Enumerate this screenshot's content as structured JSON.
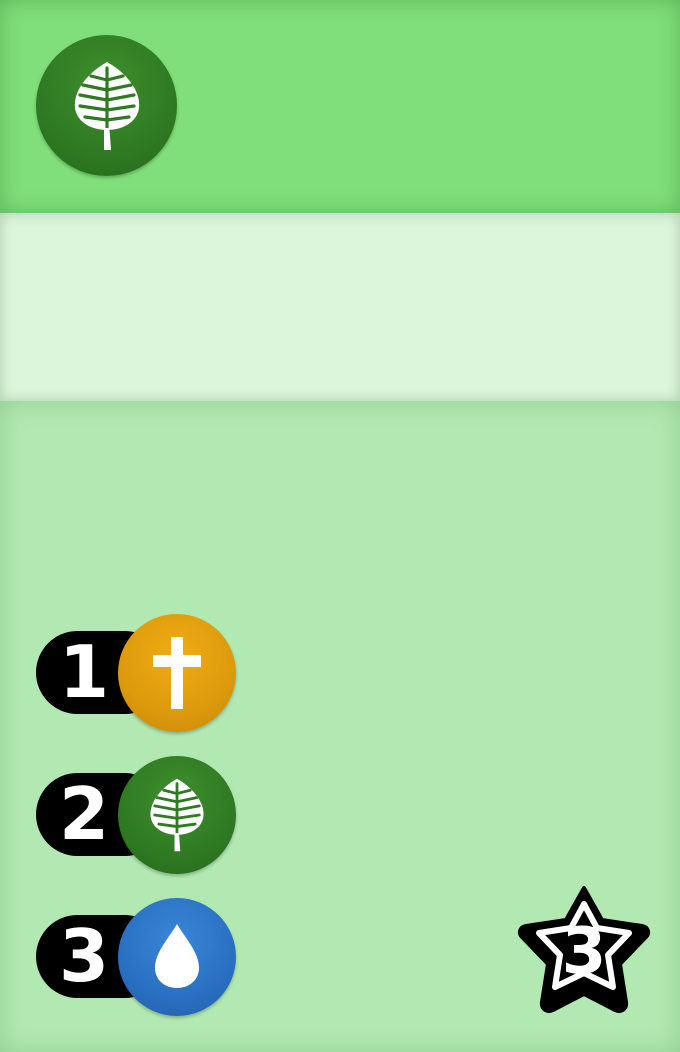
{
  "card": {
    "header_icon": "leaf-icon",
    "steps": [
      {
        "number": "1",
        "icon": "cross-icon",
        "color": "#dc9a0c"
      },
      {
        "number": "2",
        "icon": "leaf-icon",
        "color": "#2f7a22"
      },
      {
        "number": "3",
        "icon": "water-drop-icon",
        "color": "#2a70c2"
      }
    ],
    "star_value": "3",
    "colors": {
      "header": "#80df7a",
      "text_band": "#dcf6dc",
      "body": "#b2e9b2"
    }
  }
}
